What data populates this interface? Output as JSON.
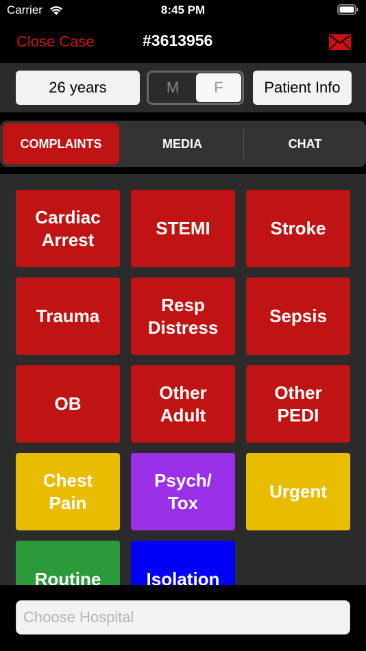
{
  "status_bar": {
    "carrier": "Carrier",
    "time": "8:45 PM",
    "wifi_icon": "wifi-icon",
    "battery_icon": "battery-icon"
  },
  "nav": {
    "close_label": "Close Case",
    "case_number": "#3613956",
    "mail_icon": "mail-icon"
  },
  "patient": {
    "age": "26 years",
    "sex_options": [
      "M",
      "F"
    ],
    "sex_selected": "F",
    "info_label": "Patient Info"
  },
  "tabs": [
    {
      "label": "COMPLAINTS",
      "active": true
    },
    {
      "label": "MEDIA",
      "active": false
    },
    {
      "label": "CHAT",
      "active": false
    }
  ],
  "complaints": [
    {
      "label": "Cardiac\nArrest",
      "color": "#c01414"
    },
    {
      "label": "STEMI",
      "color": "#c01414"
    },
    {
      "label": "Stroke",
      "color": "#c01414"
    },
    {
      "label": "Trauma",
      "color": "#c01414"
    },
    {
      "label": "Resp\nDistress",
      "color": "#c01414"
    },
    {
      "label": "Sepsis",
      "color": "#c01414"
    },
    {
      "label": "OB",
      "color": "#c01414"
    },
    {
      "label": "Other\nAdult",
      "color": "#c01414"
    },
    {
      "label": "Other\nPEDI",
      "color": "#c01414"
    },
    {
      "label": "Chest\nPain",
      "color": "#e8bc00"
    },
    {
      "label": "Psych/\nTox",
      "color": "#9a2fe8"
    },
    {
      "label": "Urgent",
      "color": "#e8bc00"
    },
    {
      "label": "Routine",
      "color": "#2a9a3a"
    },
    {
      "label": "Isolation",
      "color": "#0000f6"
    }
  ],
  "hospital": {
    "placeholder": "Choose Hospital",
    "value": ""
  },
  "colors": {
    "accent_red": "#c01414",
    "background": "#000000",
    "panel": "#2b2b2b"
  }
}
